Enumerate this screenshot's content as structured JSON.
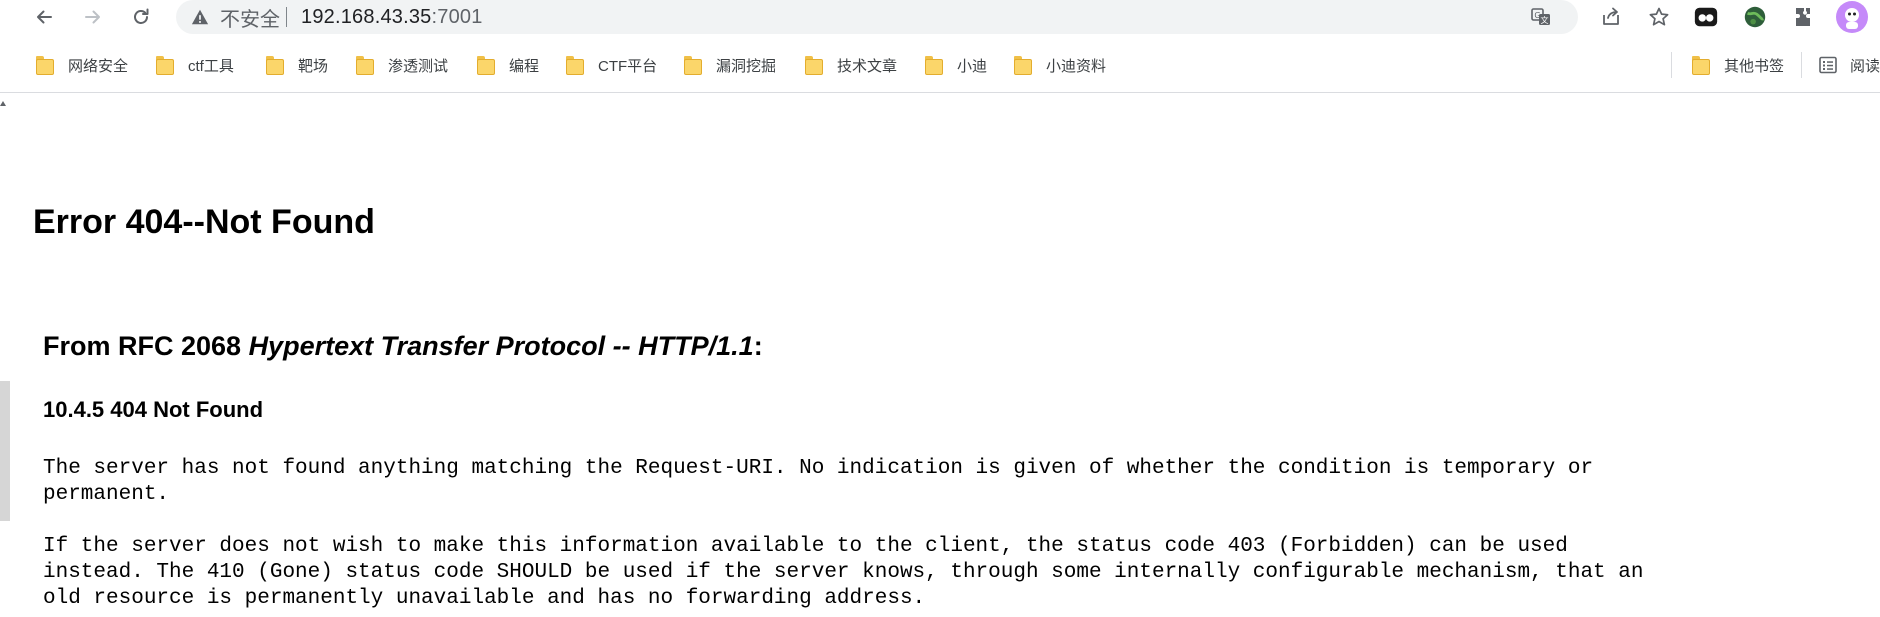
{
  "browser": {
    "omnibox": {
      "security_label": "不安全",
      "url_host": "192.168.43.35",
      "url_port": ":7001"
    },
    "icons": {
      "back": "arrow-left-icon",
      "forward": "arrow-right-icon",
      "reload": "reload-icon",
      "warning": "warning-triangle-icon",
      "translate": "translate-icon",
      "share": "share-icon",
      "bookmark": "star-icon",
      "extensions": "puzzle-icon"
    },
    "colors": {
      "omnibox_bg": "#f1f3f4",
      "folder_yellow": "#fbd66a",
      "profile_purple": "#c58af9"
    }
  },
  "bookmarks": {
    "items": [
      {
        "label": "网络安全"
      },
      {
        "label": "ctf工具"
      },
      {
        "label": "靶场"
      },
      {
        "label": "渗透测试"
      },
      {
        "label": "编程"
      },
      {
        "label": "CTF平台"
      },
      {
        "label": "漏洞挖掘"
      },
      {
        "label": "技术文章"
      },
      {
        "label": "小迪"
      },
      {
        "label": "小迪资料"
      }
    ],
    "other": {
      "label": "其他书签"
    },
    "reading_list": {
      "label": "阅读"
    }
  },
  "page": {
    "title": "Error 404--Not Found",
    "rfc_prefix": "From RFC 2068 ",
    "rfc_title": "Hypertext Transfer Protocol -- HTTP/1.1",
    "rfc_suffix": ":",
    "section": "10.4.5 404 Not Found",
    "para1_lines": [
      "The server has not found anything matching the Request-URI. No indication is given of whether the condition is temporary or",
      "permanent."
    ],
    "para2_lines": [
      "If the server does not wish to make this information available to the client, the status code 403 (Forbidden) can be used",
      "instead. The 410 (Gone) status code SHOULD be used if the server knows, through some internally configurable mechanism, that an",
      "old resource is permanently unavailable and has no forwarding address."
    ]
  }
}
